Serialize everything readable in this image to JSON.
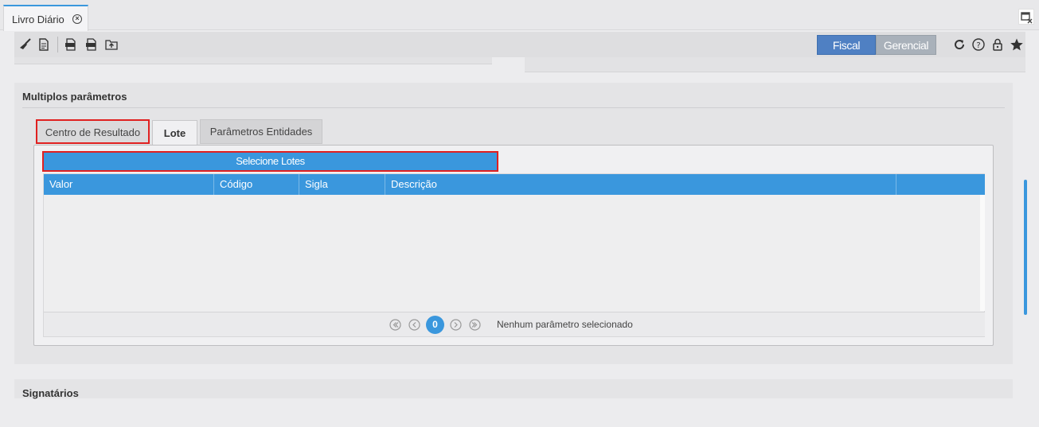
{
  "window_tab": {
    "title": "Livro Diário"
  },
  "toolbar": {
    "segments": {
      "fiscal": "Fiscal",
      "gerencial": "Gerencial"
    },
    "icons": [
      "broom-icon",
      "document-icon",
      "export-pdf-icon",
      "export-csv-icon",
      "upload-folder-icon",
      "refresh-icon",
      "help-icon",
      "lock-icon",
      "favorite-star-icon"
    ]
  },
  "sections": {
    "multiplos": {
      "title": "Multiplos parâmetros",
      "tabs": [
        "Centro de Resultado",
        "Lote",
        "Parâmetros Entidades"
      ],
      "active_tab": "Lote",
      "select_button": "Selecione Lotes",
      "grid": {
        "columns": [
          "Valor",
          "Código",
          "Sigla",
          "Descrição"
        ],
        "rows": []
      },
      "pager": {
        "page": "0",
        "status": "Nenhum parâmetro selecionado"
      }
    },
    "signatarios": {
      "title": "Signatários"
    }
  },
  "colors": {
    "accent": "#3a97dd",
    "fiscal": "#4f80c3",
    "gerencial": "#a9b1ba",
    "highlight": "#e02020"
  }
}
